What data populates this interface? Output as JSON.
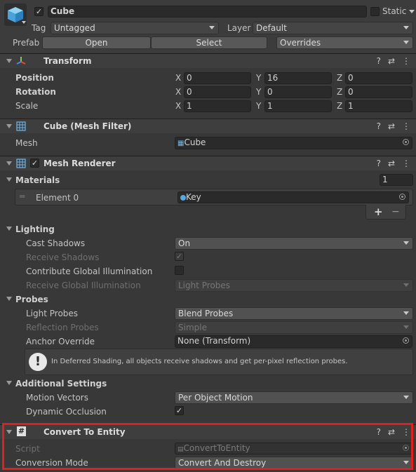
{
  "gameobject": {
    "name": "Cube",
    "static_label": "Static",
    "tag_label": "Tag",
    "tag_value": "Untagged",
    "layer_label": "Layer",
    "layer_value": "Default",
    "prefab_label": "Prefab",
    "open_label": "Open",
    "select_label": "Select",
    "overrides_label": "Overrides"
  },
  "transform": {
    "title": "Transform",
    "position_label": "Position",
    "rotation_label": "Rotation",
    "scale_label": "Scale",
    "axis_x": "X",
    "axis_y": "Y",
    "axis_z": "Z",
    "position": {
      "x": "0",
      "y": "16",
      "z": "0"
    },
    "rotation": {
      "x": "0",
      "y": "0",
      "z": "0"
    },
    "scale": {
      "x": "1",
      "y": "1",
      "z": "1"
    }
  },
  "mesh_filter": {
    "title": "Cube (Mesh Filter)",
    "mesh_label": "Mesh",
    "mesh_value": "Cube"
  },
  "mesh_renderer": {
    "title": "Mesh Renderer",
    "materials_label": "Materials",
    "materials_count": "1",
    "element0_label": "Element 0",
    "element0_value": "Key",
    "add_label": "+",
    "remove_label": "−",
    "lighting_label": "Lighting",
    "cast_shadows_label": "Cast Shadows",
    "cast_shadows_value": "On",
    "receive_shadows_label": "Receive Shadows",
    "contribute_gi_label": "Contribute Global Illumination",
    "receive_gi_label": "Receive Global Illumination",
    "receive_gi_value": "Light Probes",
    "probes_label": "Probes",
    "light_probes_label": "Light Probes",
    "light_probes_value": "Blend Probes",
    "reflection_probes_label": "Reflection Probes",
    "reflection_probes_value": "Simple",
    "anchor_override_label": "Anchor Override",
    "anchor_override_value": "None (Transform)",
    "info_text": "In Deferred Shading, all objects receive shadows and get per-pixel reflection probes.",
    "additional_label": "Additional Settings",
    "motion_vectors_label": "Motion Vectors",
    "motion_vectors_value": "Per Object Motion",
    "dynamic_occlusion_label": "Dynamic Occlusion"
  },
  "convert": {
    "title": "Convert To Entity",
    "script_label": "Script",
    "script_value": "ConvertToEntity",
    "mode_label": "Conversion Mode",
    "mode_value": "Convert And Destroy"
  },
  "icons": {
    "header_help": "help-icon",
    "header_presets": "presets-icon",
    "header_menu": "kebab-menu-icon"
  },
  "colors": {
    "background": "#383838",
    "header": "#3e3e3e",
    "field": "#2a2a2a",
    "highlight": "#e0201c",
    "cube_icon": "#5ab3ea"
  }
}
